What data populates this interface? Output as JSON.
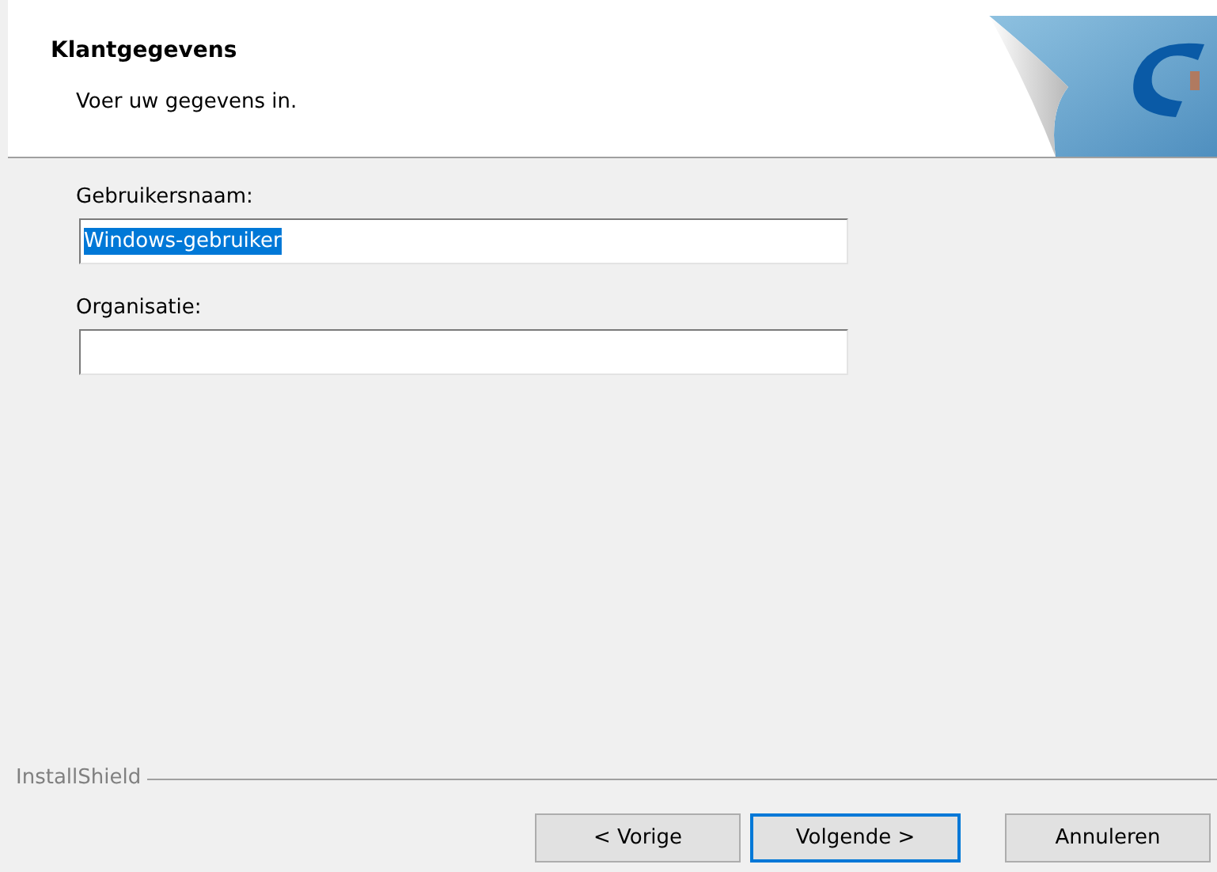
{
  "header": {
    "title": "Klantgegevens",
    "subtitle": "Voer uw gegevens in."
  },
  "fields": [
    {
      "label": "Gebruikersnaam:",
      "value": "Windows-gebruiker",
      "selected": true
    },
    {
      "label": "Organisatie:",
      "selected": false
    }
  ],
  "brand": "InstallShield",
  "buttons": [
    {
      "label": "< Vorige",
      "default": false
    },
    {
      "label": "Volgende >",
      "default": true
    },
    {
      "label": "Annuleren",
      "default": false
    }
  ]
}
